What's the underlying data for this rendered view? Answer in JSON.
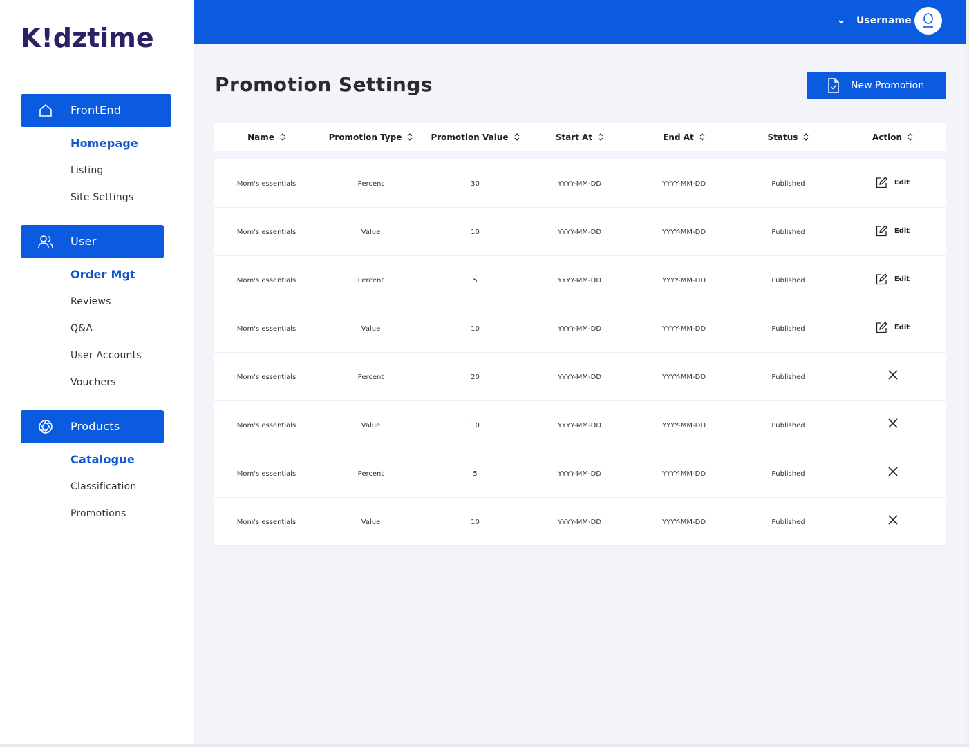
{
  "brand": {
    "logo_text": "K!dztime",
    "primary_color": "#0b5be0",
    "logo_color": "#2b2263"
  },
  "sidebar": {
    "groups": [
      {
        "label": "FrontEnd",
        "icon": "home-icon",
        "items": [
          {
            "label": "Homepage",
            "active": true
          },
          {
            "label": "Listing"
          },
          {
            "label": "Site Settings"
          }
        ]
      },
      {
        "label": "User",
        "icon": "users-icon",
        "items": [
          {
            "label": "Order Mgt",
            "active": true
          },
          {
            "label": "Reviews"
          },
          {
            "label": "Q&A"
          },
          {
            "label": "User Accounts"
          },
          {
            "label": "Vouchers"
          }
        ]
      },
      {
        "label": "Products",
        "icon": "aperture-icon",
        "items": [
          {
            "label": "Catalogue",
            "active": true
          },
          {
            "label": "Classification"
          },
          {
            "label": "Promotions"
          }
        ]
      }
    ]
  },
  "topbar": {
    "username": "Username",
    "chevron_icon": "chevron-down-icon",
    "avatar_icon": "user-icon"
  },
  "page": {
    "title": "Promotion Settings",
    "new_button": "New Promotion",
    "new_button_icon": "document-check-icon"
  },
  "table": {
    "columns": [
      "Name",
      "Promotion Type",
      "Promotion Value",
      "Start At",
      "End At",
      "Status",
      "Action"
    ],
    "edit_label": "Edit",
    "rows": [
      {
        "name": "Mom's essentials",
        "type": "Percent",
        "value": "30",
        "start": "YYYY-MM-DD",
        "end": "YYYY-MM-DD",
        "status": "Published",
        "action": "edit"
      },
      {
        "name": "Mom's essentials",
        "type": "Value",
        "value": "10",
        "start": "YYYY-MM-DD",
        "end": "YYYY-MM-DD",
        "status": "Published",
        "action": "edit"
      },
      {
        "name": "Mom's essentials",
        "type": "Percent",
        "value": "5",
        "start": "YYYY-MM-DD",
        "end": "YYYY-MM-DD",
        "status": "Published",
        "action": "edit"
      },
      {
        "name": "Mom's essentials",
        "type": "Value",
        "value": "10",
        "start": "YYYY-MM-DD",
        "end": "YYYY-MM-DD",
        "status": "Published",
        "action": "edit"
      },
      {
        "name": "Mom's essentials",
        "type": "Percent",
        "value": "20",
        "start": "YYYY-MM-DD",
        "end": "YYYY-MM-DD",
        "status": "Published",
        "action": "close"
      },
      {
        "name": "Mom's essentials",
        "type": "Value",
        "value": "10",
        "start": "YYYY-MM-DD",
        "end": "YYYY-MM-DD",
        "status": "Published",
        "action": "close"
      },
      {
        "name": "Mom's essentials",
        "type": "Percent",
        "value": "5",
        "start": "YYYY-MM-DD",
        "end": "YYYY-MM-DD",
        "status": "Published",
        "action": "close"
      },
      {
        "name": "Mom's essentials",
        "type": "Value",
        "value": "10",
        "start": "YYYY-MM-DD",
        "end": "YYYY-MM-DD",
        "status": "Published",
        "action": "close"
      }
    ]
  }
}
